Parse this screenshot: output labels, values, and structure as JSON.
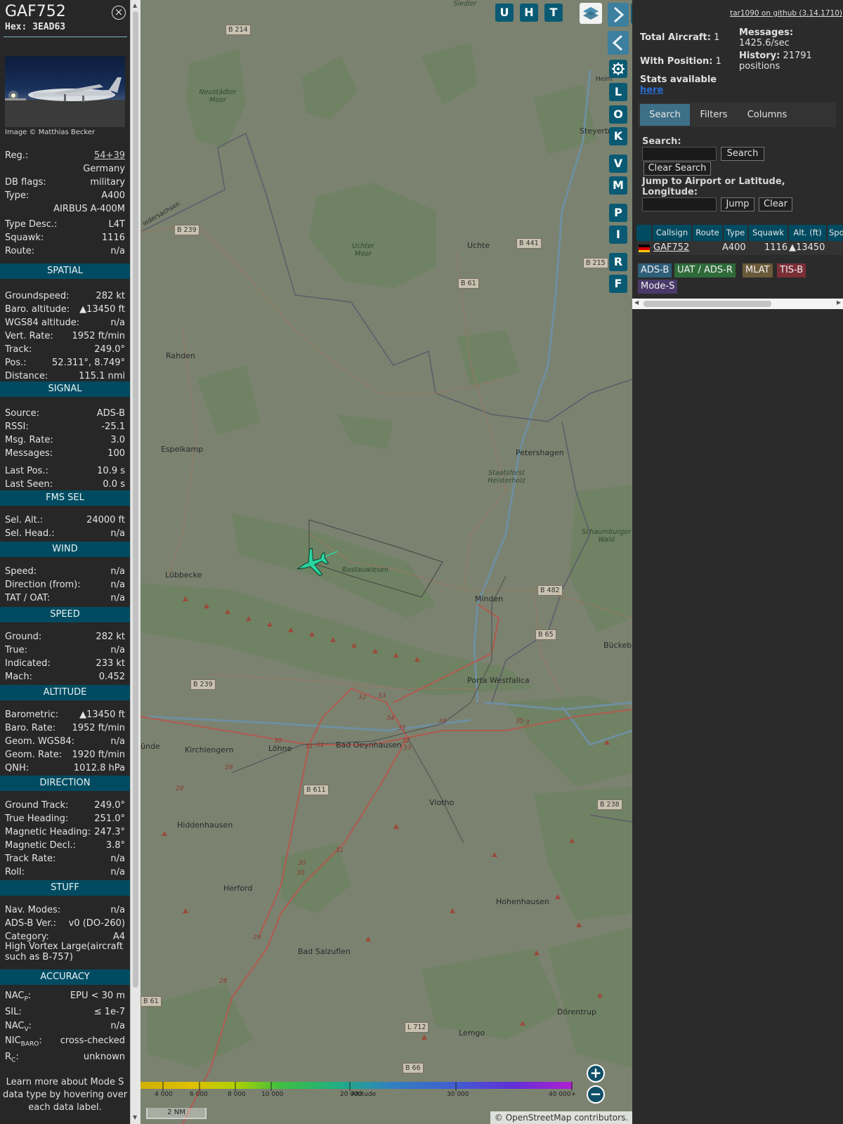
{
  "aircraft": {
    "callsign": "GAF752",
    "hex": "Hex: 3EAD63",
    "close_icon": "close-circle-icon",
    "photo_credit": "Image © Matthias Becker"
  },
  "details": {
    "reg_label": "Reg.:",
    "reg_value": "54+39",
    "country": "Germany",
    "dbflags_label": "DB flags:",
    "dbflags_value": "military",
    "type_label": "Type:",
    "type_value": "A400",
    "type_full": "AIRBUS A-400M",
    "typedesc_label": "Type Desc.:",
    "typedesc_value": "L4T",
    "squawk_label": "Squawk:",
    "squawk_value": "1116",
    "route_label": "Route:",
    "route_value": "n/a"
  },
  "sections": {
    "spatial": "SPATIAL",
    "signal": "SIGNAL",
    "fms": "FMS SEL",
    "wind": "WIND",
    "speed": "SPEED",
    "altitude": "ALTITUDE",
    "direction": "DIRECTION",
    "stuff": "STUFF",
    "accuracy": "ACCURACY"
  },
  "spatial": [
    {
      "k": "Groundspeed:",
      "v": "282 kt"
    },
    {
      "k": "Baro. altitude:",
      "v": "▲13450 ft"
    },
    {
      "k": "WGS84 altitude:",
      "v": "n/a"
    },
    {
      "k": "Vert. Rate:",
      "v": "1952 ft/min"
    },
    {
      "k": "Track:",
      "v": "249.0°"
    },
    {
      "k": "Pos.:",
      "v": "52.311°, 8.749°"
    },
    {
      "k": "Distance:",
      "v": "115.1 nmi"
    }
  ],
  "signal": [
    {
      "k": "Source:",
      "v": "ADS-B"
    },
    {
      "k": "RSSI:",
      "v": "-25.1"
    },
    {
      "k": "Msg. Rate:",
      "v": "3.0"
    },
    {
      "k": "Messages:",
      "v": "100"
    },
    {
      "k": "Last Pos.:",
      "v": "10.9 s"
    },
    {
      "k": "Last Seen:",
      "v": "0.0 s"
    }
  ],
  "fms": [
    {
      "k": "Sel. Alt.:",
      "v": "24000 ft"
    },
    {
      "k": "Sel. Head.:",
      "v": "n/a"
    }
  ],
  "wind": [
    {
      "k": "Speed:",
      "v": "n/a"
    },
    {
      "k": "Direction (from):",
      "v": "n/a"
    },
    {
      "k": "TAT / OAT:",
      "v": "n/a"
    }
  ],
  "speed": [
    {
      "k": "Ground:",
      "v": "282 kt"
    },
    {
      "k": "True:",
      "v": "n/a"
    },
    {
      "k": "Indicated:",
      "v": "233 kt"
    },
    {
      "k": "Mach:",
      "v": "0.452"
    }
  ],
  "altitude": [
    {
      "k": "Barometric:",
      "v": "▲13450 ft"
    },
    {
      "k": "Baro. Rate:",
      "v": "1952 ft/min"
    },
    {
      "k": "Geom. WGS84:",
      "v": "n/a"
    },
    {
      "k": "Geom. Rate:",
      "v": "1920 ft/min"
    },
    {
      "k": "QNH:",
      "v": "1012.8 hPa"
    }
  ],
  "direction": [
    {
      "k": "Ground Track:",
      "v": "249.0°"
    },
    {
      "k": "True Heading:",
      "v": "251.0°"
    },
    {
      "k": "Magnetic Heading:",
      "v": "247.3°"
    },
    {
      "k": "Magnetic Decl.:",
      "v": "3.8°"
    },
    {
      "k": "Track Rate:",
      "v": "n/a"
    },
    {
      "k": "Roll:",
      "v": "n/a"
    }
  ],
  "stuff": [
    {
      "k": "Nav. Modes:",
      "v": "n/a"
    },
    {
      "k": "ADS-B Ver.:",
      "v": "v0 (DO-260)"
    },
    {
      "k": "Category:",
      "v": "A4"
    }
  ],
  "category_desc": "High Vortex Large(aircraft such as B-757)",
  "accuracy": {
    "nacp_k": "NAC",
    "nacp_sub": "P",
    "nacp_colon": ":",
    "nacp_v": "EPU < 30 m",
    "sil_k": "SIL:",
    "sil_v": "≤ 1e-7",
    "nacv_k": "NAC",
    "nacv_sub": "V",
    "nacv_colon": ":",
    "nacv_v": "n/a",
    "nicbaro_k": "NIC",
    "nicbaro_sub": "BARO",
    "nicbaro_colon": ":",
    "nicbaro_v": "cross-checked",
    "rc_k": "R",
    "rc_sub": "C",
    "rc_colon": ":",
    "rc_v": "unknown"
  },
  "learn_more": "Learn more about Mode S data type by hovering over each data label.",
  "map": {
    "towns": {
      "rahden": "Rahden",
      "espelkamp": "Espelkamp",
      "petershagen": "Petershagen",
      "uchte": "Uchte",
      "luebbecke": "Lübbecke",
      "minden": "Minden",
      "porta": "Porta Westfalica",
      "kirchlengern": "Kirchlengern",
      "loehne": "Löhne",
      "oeynhausen": "Bad Oeynhausen",
      "vlotho": "Vlotho",
      "hiddenhausen": "Hiddenhausen",
      "herford": "Herford",
      "hohenhausen": "Hohenhausen",
      "salzuflen": "Bad Salzuflen",
      "doerentrup": "Dörentrup",
      "lemgo": "Lemgo",
      "steyerberg": "Steyerbe",
      "bueckeburg": "Bückebu",
      "buende": "ünde",
      "niedersachsen": "iedersachsen",
      "heim": "Heim"
    },
    "natural": {
      "neustaedter": "Neustädter Moor",
      "uchter": "Uchter Moor",
      "staatsforst": "Staatsforst Heisterholz",
      "schaumburger": "Schaumburger Wald",
      "bastau": "Bastauwiesen",
      "siedler": "Siedler"
    },
    "roads": {
      "b214": "B 214",
      "b239a": "B 239",
      "b441": "B 441",
      "b215": "B 215",
      "b61": "B 61",
      "b482": "B 482",
      "b65": "B 65",
      "b239b": "B 239",
      "b611": "B 611",
      "b238": "B 238",
      "l712": "L 712",
      "b66": "B 66",
      "b61b": "B 61"
    },
    "exits": [
      "32",
      "33",
      "34",
      "35",
      "32",
      "33",
      "34",
      "35",
      "30",
      "31",
      "31",
      "29",
      "28",
      "31",
      "30",
      "30",
      "29",
      "28",
      "3"
    ],
    "buttons": {
      "u": "U",
      "h": "H",
      "t": "T",
      "l": "L",
      "o": "O",
      "k": "K",
      "v": "V",
      "m": "M",
      "p": "P",
      "i": "I",
      "r": "R",
      "f": "F"
    },
    "icons": {
      "layers": "layers-icon",
      "next": "chevron-right-icon",
      "prev": "chevron-left-icon",
      "settings": "gear-icon",
      "expand": "expand-horizontal-icon",
      "zoom_in": "plus-icon",
      "zoom_out": "minus-icon",
      "aircraft": "airplane-icon"
    },
    "zoom_in": "+",
    "zoom_out": "−",
    "altitude_scale": [
      "4 000",
      "6 000",
      "8 000",
      "10 000",
      "20 000",
      "30 000",
      "40 000+"
    ],
    "altitude_scale_label": "Altitude",
    "scale_bar": "2 NM",
    "attribution_prefix": "© ",
    "attribution_link": "OpenStreetMap",
    "attribution_suffix": " contributors."
  },
  "side": {
    "github": "tar1090 on github (3.14.1710)",
    "total_label": "Total Aircraft:",
    "total_value": "1",
    "withpos_label": "With Position:",
    "withpos_value": "1",
    "stats_label": "Stats available",
    "stats_link": "here",
    "messages_label": "Messages:",
    "messages_value": "1425.6/sec",
    "history_label": "History:",
    "history_value": "21791 positions",
    "tabs": [
      "Search",
      "Filters",
      "Columns"
    ],
    "search_label": "Search:",
    "search_btn": "Search",
    "clear_search_btn": "Clear Search",
    "jump_label": "Jump to Airport or Latitude, Longitude:",
    "jump_btn": "Jump",
    "clear_btn": "Clear",
    "search_value": "",
    "jump_value": "",
    "columns": [
      "Callsign",
      "Route",
      "Type",
      "Squawk",
      "Alt. (ft)",
      "Spd"
    ],
    "row": {
      "callsign": "GAF752",
      "route": "",
      "type": "A400",
      "squawk": "1116",
      "alt": "▲13450",
      "flag": "germany-flag-icon"
    },
    "legend": [
      "ADS-B",
      "UAT / ADS-R",
      "MLAT",
      "TIS-B",
      "Mode-S"
    ],
    "legend_colors": [
      "#2f5e79",
      "#2f6a3a",
      "#6a5a3a",
      "#7a2f36",
      "#4a3a6a"
    ]
  },
  "colors": {
    "section": "#004b61",
    "accent": "#3d6f87",
    "aircraft": "#2ad4a0",
    "panel": "#272727"
  }
}
